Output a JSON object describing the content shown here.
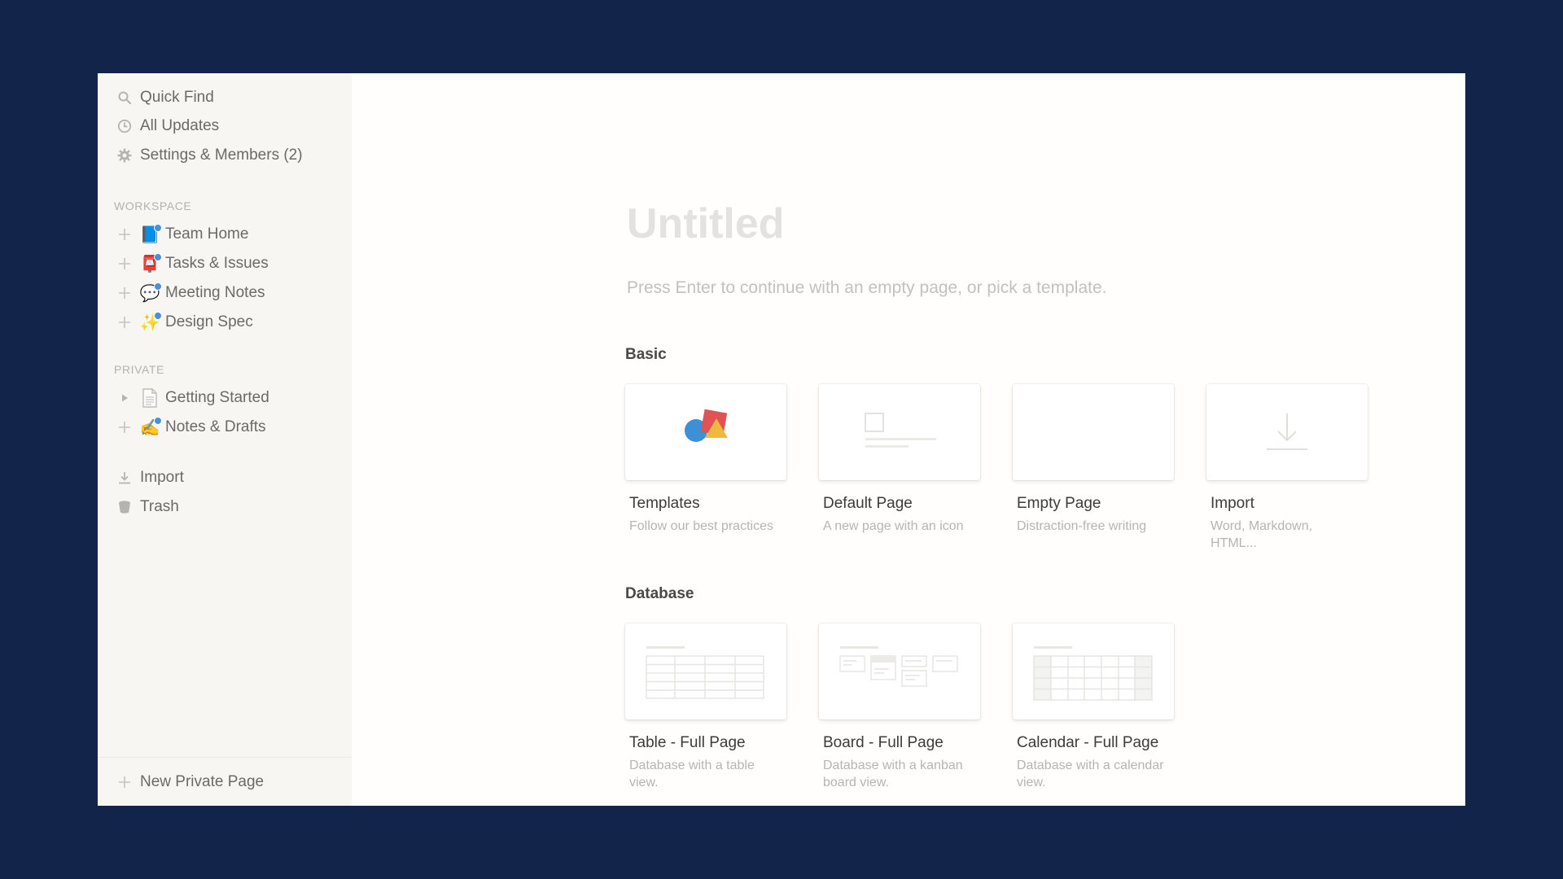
{
  "sidebar": {
    "top_items": [
      {
        "label": "Quick Find",
        "icon": "search-icon"
      },
      {
        "label": "All Updates",
        "icon": "clock-icon"
      },
      {
        "label": "Settings & Members (2)",
        "icon": "gear-icon"
      }
    ],
    "workspace_label": "WORKSPACE",
    "workspace_pages": [
      {
        "label": "Team Home",
        "emoji": "📘",
        "icon": "blue-book-icon"
      },
      {
        "label": "Tasks & Issues",
        "emoji": "📮",
        "icon": "mailbox-icon"
      },
      {
        "label": "Meeting Notes",
        "emoji": "💬",
        "icon": "speech-balloon-icon"
      },
      {
        "label": "Design Spec",
        "emoji": "✨",
        "icon": "sparkle-icon"
      }
    ],
    "private_label": "PRIVATE",
    "private_pages": [
      {
        "label": "Getting Started",
        "emoji": "📄",
        "icon": "page-icon",
        "expander": "triangle"
      },
      {
        "label": "Notes & Drafts",
        "emoji": "✍️",
        "icon": "writing-hand-icon",
        "expander": "plus"
      }
    ],
    "utility_items": [
      {
        "label": "Import",
        "icon": "import-icon"
      },
      {
        "label": "Trash",
        "icon": "trash-icon"
      }
    ],
    "new_page_label": "New Private Page"
  },
  "main": {
    "title_placeholder": "Untitled",
    "hint": "Press Enter to continue with an empty page, or pick a template.",
    "groups": [
      {
        "title": "Basic",
        "cards": [
          {
            "name": "Templates",
            "desc": "Follow our best practices",
            "thumb": "templates-shapes"
          },
          {
            "name": "Default Page",
            "desc": "A new page with an icon",
            "thumb": "default-page"
          },
          {
            "name": "Empty Page",
            "desc": "Distraction-free writing",
            "thumb": "empty"
          },
          {
            "name": "Import",
            "desc": "Word, Markdown, HTML...",
            "thumb": "import-arrow"
          }
        ]
      },
      {
        "title": "Database",
        "cards": [
          {
            "name": "Table - Full Page",
            "desc": "Database with a table view.",
            "thumb": "table"
          },
          {
            "name": "Board - Full Page",
            "desc": "Database with a kanban board view.",
            "thumb": "board"
          },
          {
            "name": "Calendar - Full Page",
            "desc": "Database with a calendar view.",
            "thumb": "calendar"
          }
        ]
      }
    ],
    "help_label": "?"
  },
  "colors": {
    "backdrop": "#12244a",
    "sidebar_bg": "#f7f6f3",
    "main_bg": "#fffefc",
    "accent_blue": "#4a90d9",
    "shape_red": "#e05253",
    "shape_blue": "#3d8fd6",
    "shape_yellow": "#efb940"
  }
}
